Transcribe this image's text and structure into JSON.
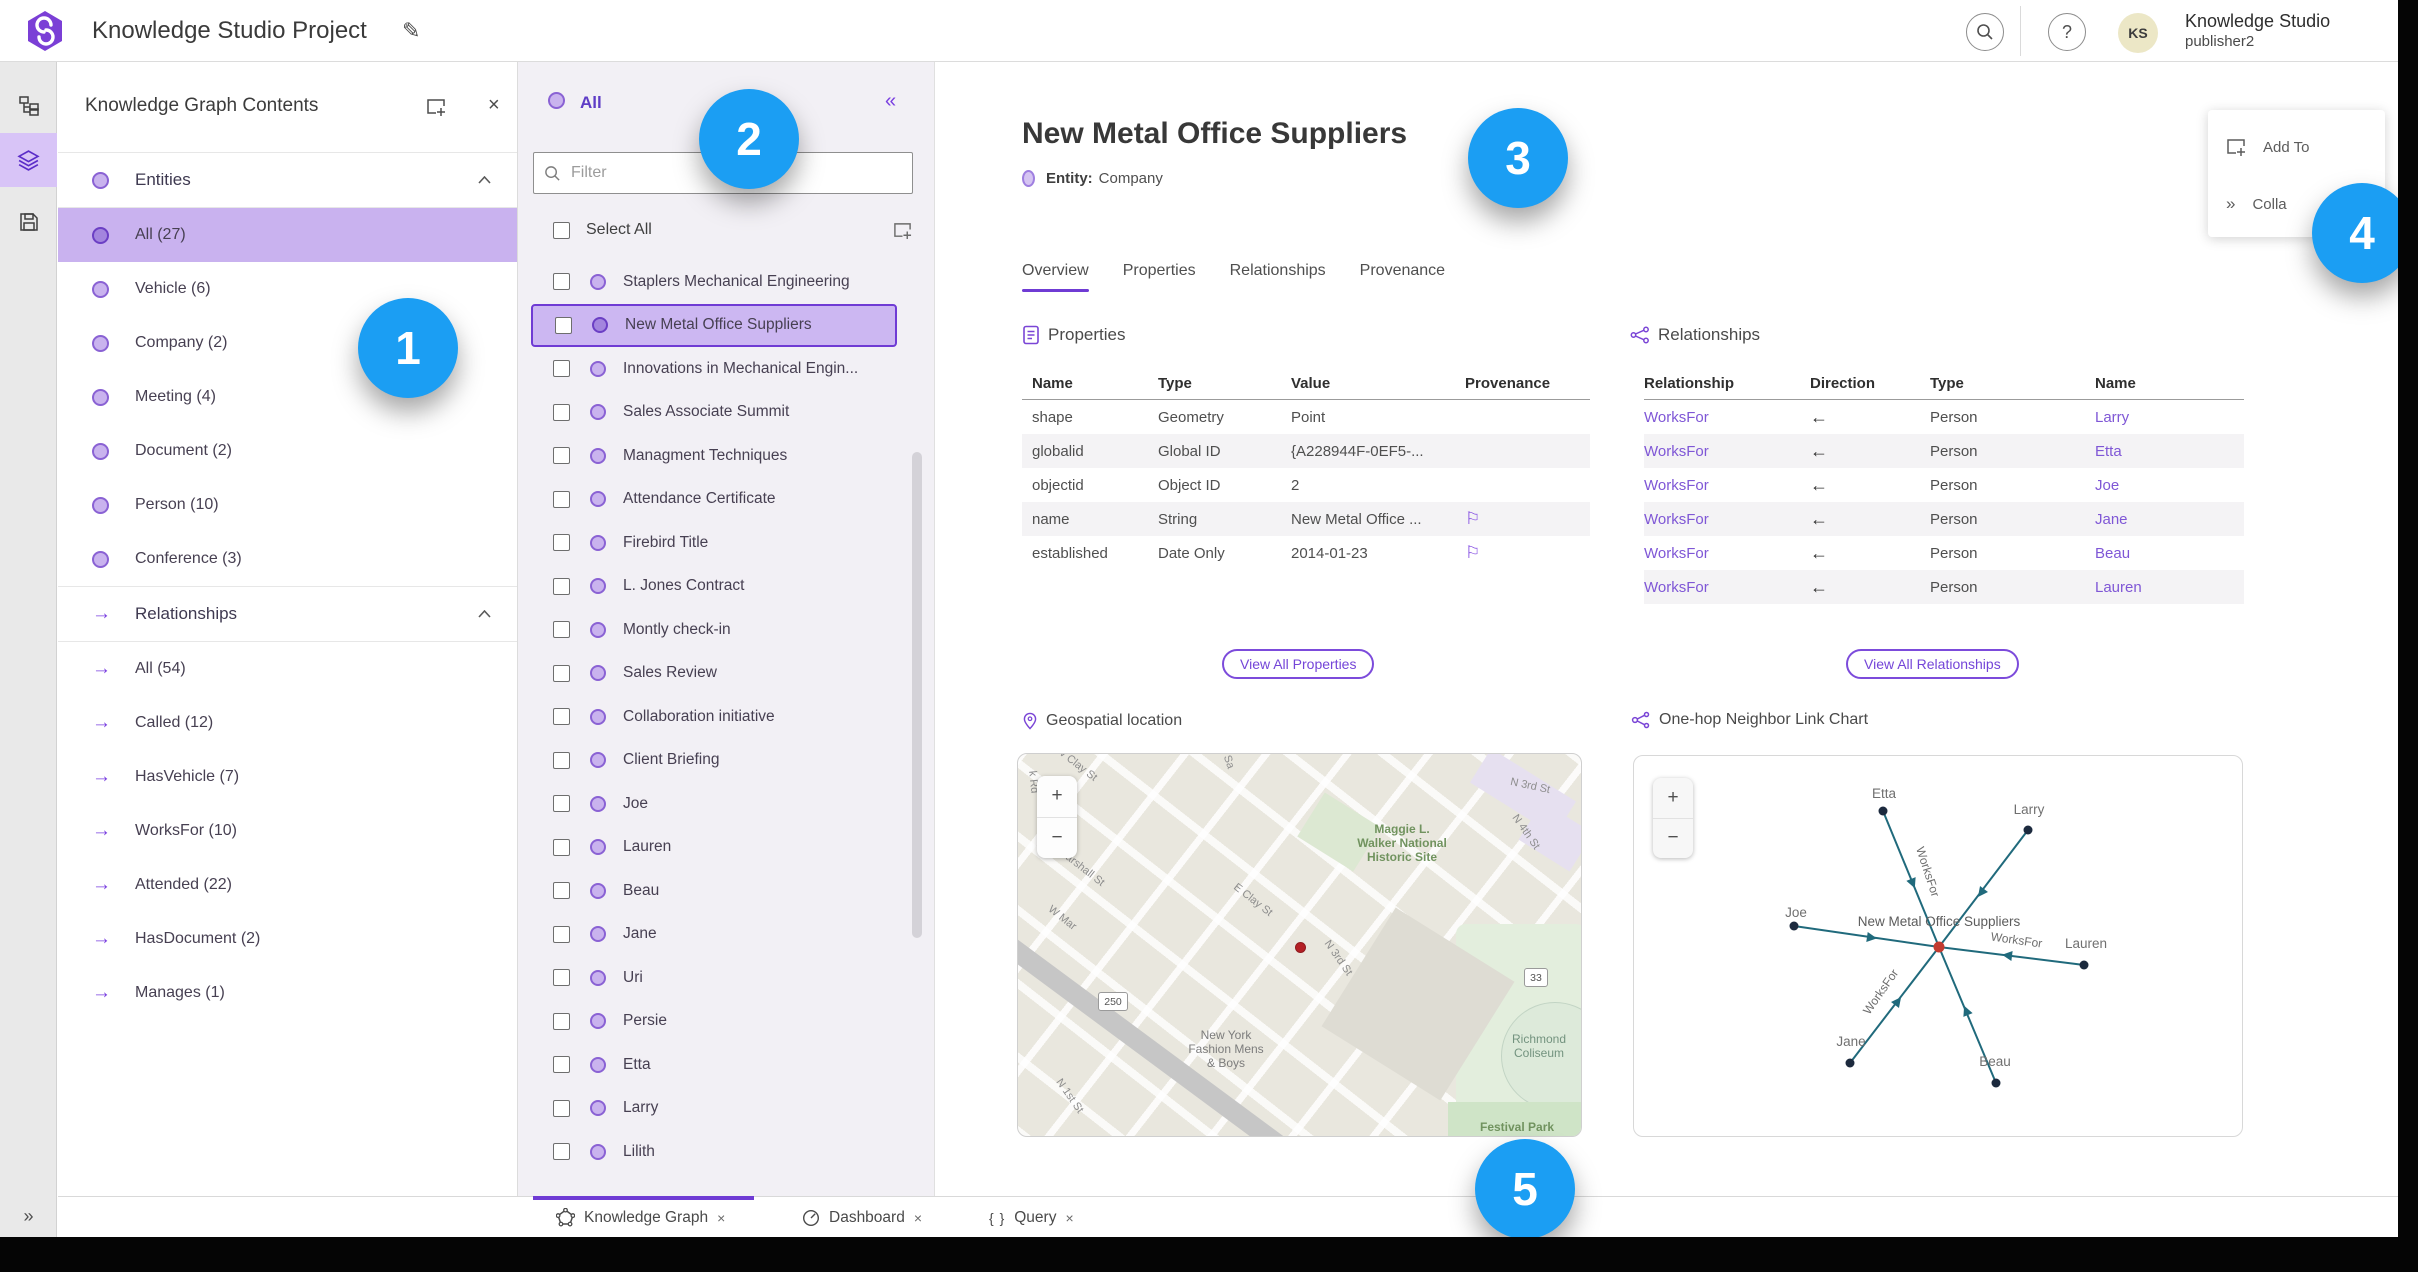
{
  "glyphs": {
    "close": "×",
    "collapse": "«",
    "expand": "»",
    "edit": "✎",
    "plus": "+",
    "minus": "−",
    "question": "?",
    "braces": "{ }",
    "flag": "⚐",
    "arrow_right": "→"
  },
  "header": {
    "title": "Knowledge Studio Project",
    "account_name": "Knowledge Studio",
    "account_user": "publisher2",
    "avatar_initials": "KS"
  },
  "kg_panel": {
    "title": "Knowledge Graph Contents",
    "entities_label": "Entities",
    "relationships_label": "Relationships",
    "entities": [
      "All (27)",
      "Vehicle (6)",
      "Company (2)",
      "Meeting (4)",
      "Document (2)",
      "Person (10)",
      "Conference (3)"
    ],
    "relationships": [
      "All (54)",
      "Called (12)",
      "HasVehicle (7)",
      "WorksFor (10)",
      "Attended (22)",
      "HasDocument (2)",
      "Manages (1)"
    ]
  },
  "mid_panel": {
    "header": "All",
    "filter_placeholder": "Filter",
    "select_all_label": "Select All",
    "selected_item": "New Metal Office Suppliers",
    "items": [
      "Staplers Mechanical Engineering",
      "New Metal Office Suppliers",
      "Innovations in Mechanical Engin...",
      "Sales Associate Summit",
      "Managment Techniques",
      "Attendance Certificate",
      "Firebird Title",
      "L. Jones Contract",
      "Montly check-in",
      "Sales Review",
      "Collaboration initiative",
      "Client Briefing",
      "Joe",
      "Lauren",
      "Beau",
      "Jane",
      "Uri",
      "Persie",
      "Etta",
      "Larry",
      "Lilith"
    ]
  },
  "detail": {
    "title": "New Metal Office Suppliers",
    "entity_label": "Entity:",
    "entity_type": "Company",
    "tabs": [
      "Overview",
      "Properties",
      "Relationships",
      "Provenance"
    ],
    "active_tab": "Overview",
    "properties": {
      "section_title": "Properties",
      "columns": [
        "Name",
        "Type",
        "Value",
        "Provenance"
      ],
      "rows": [
        {
          "name": "shape",
          "type": "Geometry",
          "value": "Point"
        },
        {
          "name": "globalid",
          "type": "Global ID",
          "value": "{A228944F-0EF5-..."
        },
        {
          "name": "objectid",
          "type": "Object ID",
          "value": "2"
        },
        {
          "name": "name",
          "type": "String",
          "value": "New Metal Office ..."
        },
        {
          "name": "established",
          "type": "Date Only",
          "value": "2014-01-23"
        }
      ],
      "view_all_label": "View All Properties"
    },
    "relationships": {
      "section_title": "Relationships",
      "columns": [
        "Relationship",
        "Direction",
        "Type",
        "Name"
      ],
      "rows": [
        {
          "relationship": "WorksFor",
          "direction": "←",
          "type": "Person",
          "name": "Larry"
        },
        {
          "relationship": "WorksFor",
          "direction": "←",
          "type": "Person",
          "name": "Etta"
        },
        {
          "relationship": "WorksFor",
          "direction": "←",
          "type": "Person",
          "name": "Joe"
        },
        {
          "relationship": "WorksFor",
          "direction": "←",
          "type": "Person",
          "name": "Jane"
        },
        {
          "relationship": "WorksFor",
          "direction": "←",
          "type": "Person",
          "name": "Beau"
        },
        {
          "relationship": "WorksFor",
          "direction": "←",
          "type": "Person",
          "name": "Lauren"
        }
      ],
      "view_all_label": "View All Relationships"
    },
    "map": {
      "section_title": "Geospatial location",
      "labels": {
        "k_rd": "k Rd",
        "w_clay": "W Clay St",
        "sa": "Sa",
        "n3rd_top": "N 3rd St",
        "maggie": "Maggie L.\nWalker National\nHistoric Site",
        "n4th": "N 4th St",
        "e_clay": "E Clay St",
        "marshall": "arshall St",
        "w_mar": "W Mar",
        "n3rd_mid": "N 3rd St",
        "n1st": "N 1st St",
        "ny_fashion": "New York\nFashion Mens\n& Boys",
        "coliseum": "Richmond\nColiseum",
        "festival": "Festival Park",
        "shield_250": "250",
        "shield_33": "33"
      }
    },
    "link_chart": {
      "section_title": "One-hop Neighbor Link Chart",
      "center_label": "New Metal Office Suppliers",
      "edge_label": "WorksFor",
      "nodes": {
        "etta": "Etta",
        "larry": "Larry",
        "joe": "Joe",
        "lauren": "Lauren",
        "jane": "Jane",
        "beau": "Beau"
      }
    }
  },
  "flyout": {
    "add_to": "Add To",
    "collapse": "Colla"
  },
  "bottom_tabs": {
    "items": [
      {
        "label": "Knowledge Graph"
      },
      {
        "label": "Dashboard"
      },
      {
        "label": "Query"
      }
    ]
  },
  "badges": [
    "1",
    "2",
    "3",
    "4",
    "5"
  ]
}
